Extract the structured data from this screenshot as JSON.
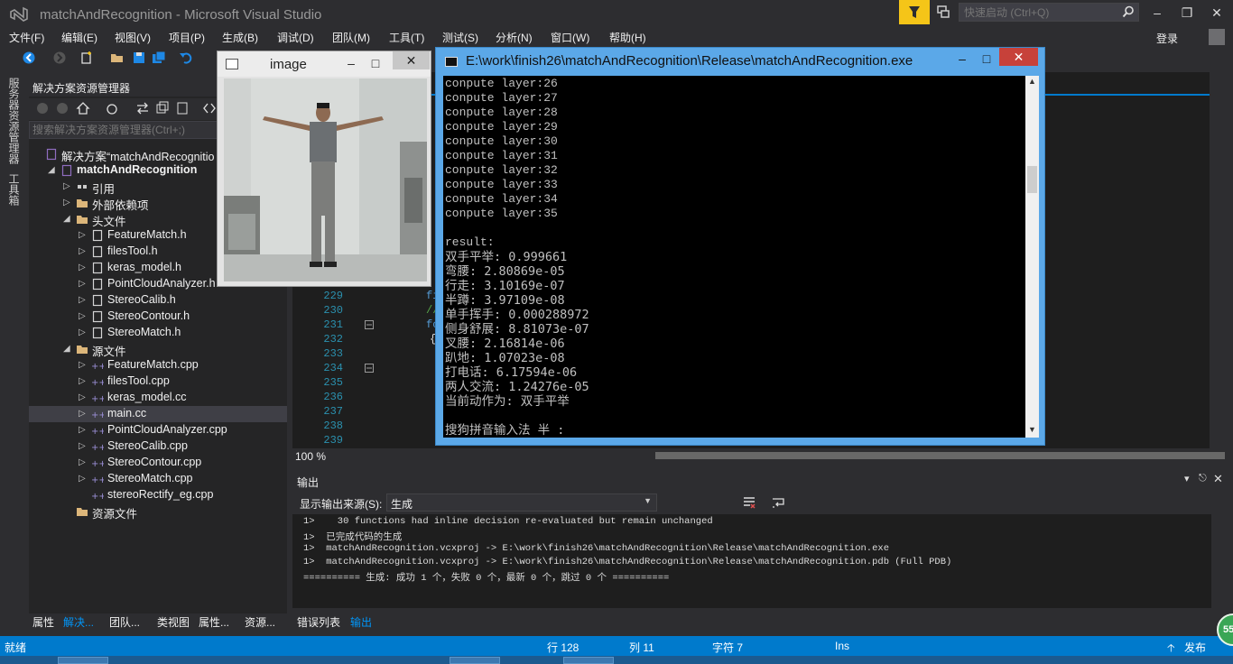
{
  "window": {
    "app_title": "matchAndRecognition - Microsoft Visual Studio",
    "quick_launch_placeholder": "快速启动 (Ctrl+Q)",
    "sign_in": "登录"
  },
  "menu": [
    "文件(F)",
    "编辑(E)",
    "视图(V)",
    "项目(P)",
    "生成(B)",
    "调试(D)",
    "团队(M)",
    "工具(T)",
    "测试(S)",
    "分析(N)",
    "窗口(W)",
    "帮助(H)"
  ],
  "left_strip": {
    "tabs": [
      "服务器资源管理器",
      "工具箱"
    ]
  },
  "solution_explorer": {
    "title": "解决方案资源管理器",
    "search_placeholder": "搜索解决方案资源管理器(Ctrl+;)",
    "items": [
      {
        "label": "解决方案“matchAndRecognitio",
        "icon": "solution-icon",
        "indent": 0,
        "arrow": ""
      },
      {
        "label": "matchAndRecognition",
        "icon": "project-icon",
        "indent": 1,
        "arrow": "down",
        "bold": true
      },
      {
        "label": "引用",
        "icon": "references-icon",
        "indent": 2,
        "arrow": "right"
      },
      {
        "label": "外部依赖项",
        "icon": "folder-icon",
        "indent": 2,
        "arrow": "right"
      },
      {
        "label": "头文件",
        "icon": "folder-icon",
        "indent": 2,
        "arrow": "down"
      },
      {
        "label": "FeatureMatch.h",
        "icon": "header-file-icon",
        "indent": 3,
        "arrow": "right"
      },
      {
        "label": "filesTool.h",
        "icon": "header-file-icon",
        "indent": 3,
        "arrow": "right"
      },
      {
        "label": "keras_model.h",
        "icon": "header-file-icon",
        "indent": 3,
        "arrow": "right"
      },
      {
        "label": "PointCloudAnalyzer.h",
        "icon": "header-file-icon",
        "indent": 3,
        "arrow": "right"
      },
      {
        "label": "StereoCalib.h",
        "icon": "header-file-icon",
        "indent": 3,
        "arrow": "right"
      },
      {
        "label": "StereoContour.h",
        "icon": "header-file-icon",
        "indent": 3,
        "arrow": "right"
      },
      {
        "label": "StereoMatch.h",
        "icon": "header-file-icon",
        "indent": 3,
        "arrow": "right"
      },
      {
        "label": "源文件",
        "icon": "folder-icon",
        "indent": 2,
        "arrow": "down"
      },
      {
        "label": "FeatureMatch.cpp",
        "icon": "cpp-file-icon",
        "indent": 3,
        "arrow": "right"
      },
      {
        "label": "filesTool.cpp",
        "icon": "cpp-file-icon",
        "indent": 3,
        "arrow": "right"
      },
      {
        "label": "keras_model.cc",
        "icon": "cpp-file-icon",
        "indent": 3,
        "arrow": "right"
      },
      {
        "label": "main.cc",
        "icon": "cpp-file-icon",
        "indent": 3,
        "arrow": "right",
        "selected": true
      },
      {
        "label": "PointCloudAnalyzer.cpp",
        "icon": "cpp-file-icon",
        "indent": 3,
        "arrow": "right"
      },
      {
        "label": "StereoCalib.cpp",
        "icon": "cpp-file-icon",
        "indent": 3,
        "arrow": "right"
      },
      {
        "label": "StereoContour.cpp",
        "icon": "cpp-file-icon",
        "indent": 3,
        "arrow": "right"
      },
      {
        "label": "StereoMatch.cpp",
        "icon": "cpp-file-icon",
        "indent": 3,
        "arrow": "right"
      },
      {
        "label": "stereoRectify_eg.cpp",
        "icon": "cpp-file-icon",
        "indent": 3,
        "arrow": ""
      },
      {
        "label": "资源文件",
        "icon": "folder-icon",
        "indent": 2,
        "arrow": ""
      }
    ],
    "bottom_tabs": [
      "属性",
      "解决...",
      "团队...",
      "类视图",
      "属性...",
      "资源..."
    ]
  },
  "editor": {
    "line_numbers": [
      "229",
      "230",
      "231",
      "232",
      "233",
      "234",
      "235",
      "236",
      "237",
      "238",
      "239"
    ],
    "code_fragments": [
      "fi",
      "//",
      "fo",
      "{"
    ],
    "zoom": "100 %"
  },
  "image_window": {
    "title": "image"
  },
  "console_window": {
    "title": "E:\\work\\finish26\\matchAndRecognition\\Release\\matchAndRecognition.exe",
    "lines": [
      "conpute layer:26",
      "conpute layer:27",
      "conpute layer:28",
      "conpute layer:29",
      "conpute layer:30",
      "conpute layer:31",
      "conpute layer:32",
      "conpute layer:33",
      "conpute layer:34",
      "conpute layer:35",
      "",
      "result:",
      "双手平举: 0.999661",
      "弯腰: 2.80869e-05",
      "行走: 3.10169e-07",
      "半蹲: 3.97109e-08",
      "单手挥手: 0.000288972",
      "侧身舒展: 8.81073e-07",
      "叉腰: 2.16814e-06",
      "趴地: 1.07023e-08",
      "打电话: 6.17594e-06",
      "两人交流: 1.24276e-05",
      "当前动作为: 双手平举",
      "",
      "搜狗拼音输入法 半 :"
    ]
  },
  "output_panel": {
    "title": "输出",
    "source_label": "显示输出来源(S):",
    "source_value": "生成",
    "lines": [
      "1>    30 functions had inline decision re-evaluated but remain unchanged",
      "1>  已完成代码的生成",
      "1>  matchAndRecognition.vcxproj -> E:\\work\\finish26\\matchAndRecognition\\Release\\matchAndRecognition.exe",
      "1>  matchAndRecognition.vcxproj -> E:\\work\\finish26\\matchAndRecognition\\Release\\matchAndRecognition.pdb (Full PDB)",
      "========== 生成: 成功 1 个，失败 0 个，最新 0 个，跳过 0 个 =========="
    ],
    "tabs": [
      "错误列表",
      "输出"
    ]
  },
  "status_bar": {
    "ready": "就绪",
    "row": "行 128",
    "col": "列 11",
    "char": "字符 7",
    "mode": "Ins",
    "publish": "发布",
    "badge": "55"
  },
  "colors": {
    "accent": "#007acc",
    "bg_dark": "#2d2d30",
    "editor_bg": "#1e1e1e",
    "console_frame": "#5ba8e8",
    "notification": "#f5c518"
  }
}
